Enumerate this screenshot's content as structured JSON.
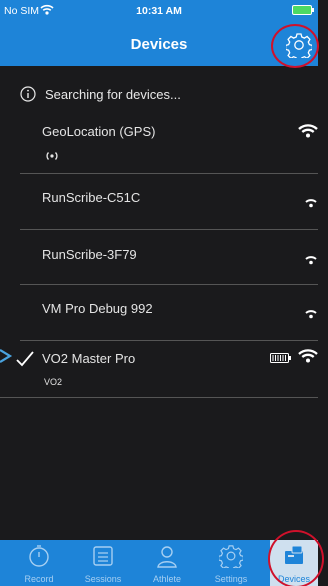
{
  "status_bar": {
    "carrier": "No SIM",
    "time": "10:31 AM"
  },
  "header": {
    "title": "Devices"
  },
  "list": {
    "searching": "Searching for devices...",
    "devices": [
      {
        "name": "GeoLocation (GPS)",
        "sub": ""
      },
      {
        "name": "RunScribe-C51C"
      },
      {
        "name": "RunScribe-3F79"
      },
      {
        "name": "VM Pro Debug 992"
      },
      {
        "name": "VO2 Master Pro",
        "sub": "VO2",
        "selected": true
      }
    ]
  },
  "tabs": [
    {
      "label": "Record",
      "icon": "stopwatch-icon"
    },
    {
      "label": "Sessions",
      "icon": "list-icon"
    },
    {
      "label": "Athlete",
      "icon": "person-icon"
    },
    {
      "label": "Settings",
      "icon": "gear-icon"
    },
    {
      "label": "Devices",
      "icon": "devices-icon",
      "active": true
    }
  ],
  "colors": {
    "accent": "#1e84d8",
    "background": "#1a1a1c",
    "highlight": "#d0112b"
  }
}
